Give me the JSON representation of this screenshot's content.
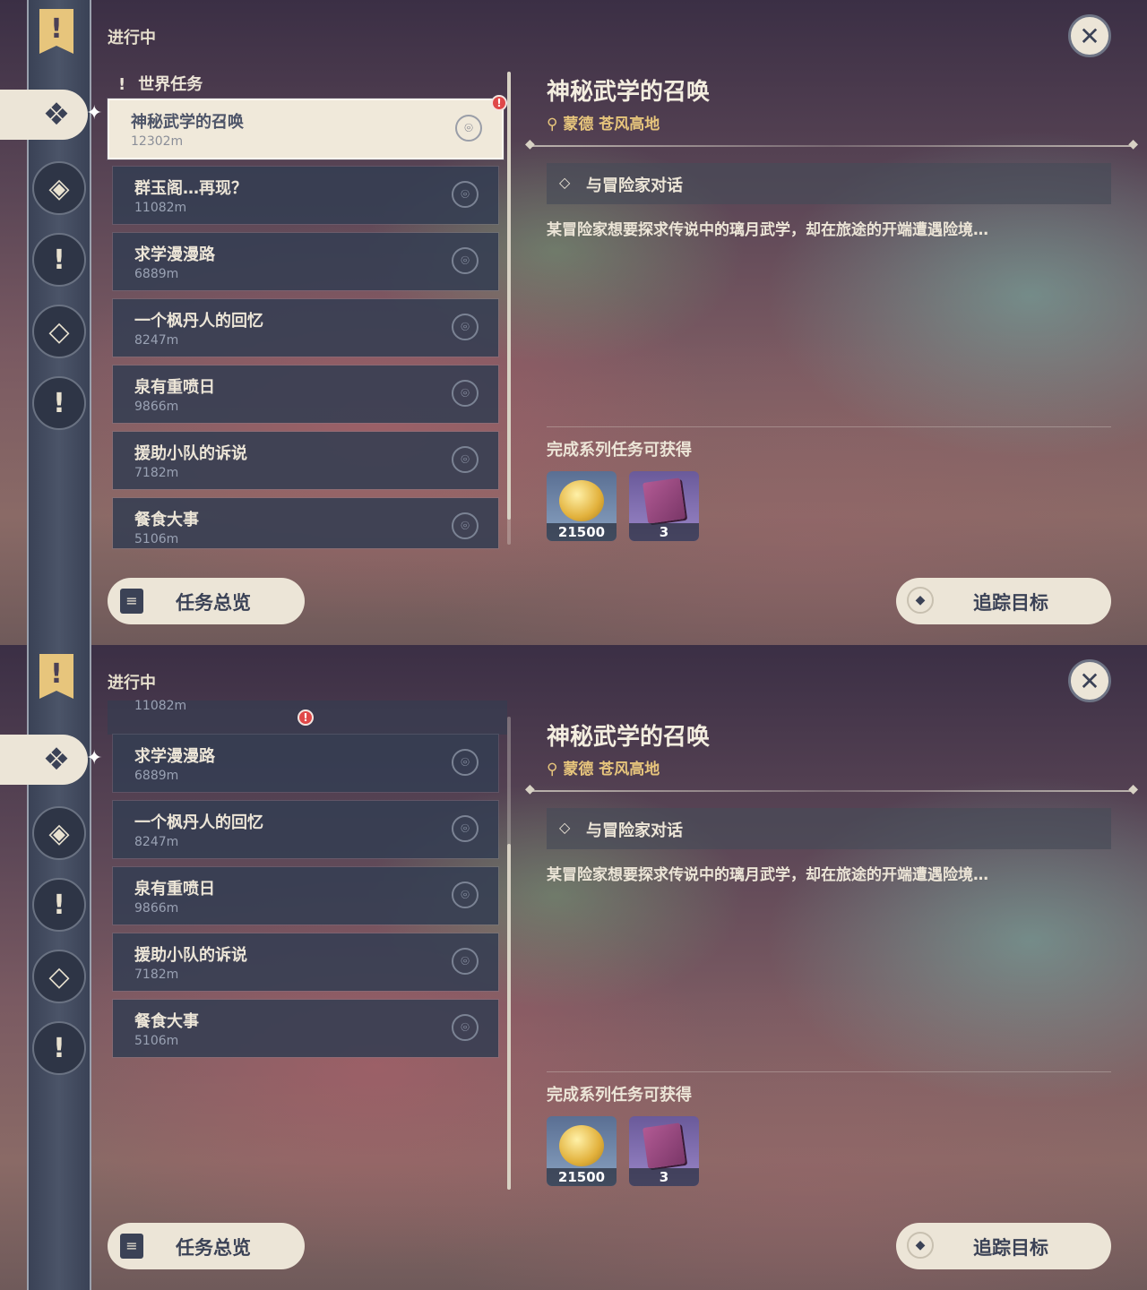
{
  "panels": [
    {
      "status_label": "进行中",
      "category_label": "世界任务",
      "close_label": "✕",
      "quests": [
        {
          "name": "神秘武学的召唤",
          "distance": "12302m"
        },
        {
          "name": "群玉阁…再现？",
          "distance": "11082m"
        },
        {
          "name": "求学漫漫路",
          "distance": "6889m"
        },
        {
          "name": "一个枫丹人的回忆",
          "distance": "8247m"
        },
        {
          "name": "泉有重喷日",
          "distance": "9866m"
        },
        {
          "name": "援助小队的诉说",
          "distance": "7182m"
        },
        {
          "name": "餐食大事",
          "distance": "5106m"
        }
      ],
      "detail": {
        "title": "神秘武学的召唤",
        "location": "蒙德 苍风高地",
        "objective": "与冒险家对话",
        "description": "某冒险家想要探求传说中的璃月武学，却在旅途的开端遭遇险境…",
        "rewards_label": "完成系列任务可获得",
        "rewards": [
          {
            "icon": "mora-coin-icon",
            "count": "21500"
          },
          {
            "icon": "book-icon",
            "count": "3"
          }
        ]
      },
      "overview_label": "任务总览",
      "track_label": "追踪目标"
    },
    {
      "status_label": "进行中",
      "top_partial_distance": "11082m",
      "close_label": "✕",
      "quests": [
        {
          "name": "求学漫漫路",
          "distance": "6889m"
        },
        {
          "name": "一个枫丹人的回忆",
          "distance": "8247m"
        },
        {
          "name": "泉有重喷日",
          "distance": "9866m"
        },
        {
          "name": "援助小队的诉说",
          "distance": "7182m"
        },
        {
          "name": "餐食大事",
          "distance": "5106m"
        }
      ],
      "detail": {
        "title": "神秘武学的召唤",
        "location": "蒙德 苍风高地",
        "objective": "与冒险家对话",
        "description": "某冒险家想要探求传说中的璃月武学，却在旅途的开端遭遇险境…",
        "rewards_label": "完成系列任务可获得",
        "rewards": [
          {
            "icon": "mora-coin-icon",
            "count": "21500"
          },
          {
            "icon": "book-icon",
            "count": "3"
          }
        ]
      },
      "overview_label": "任务总览",
      "track_label": "追踪目标"
    }
  ],
  "colors": {
    "accent_gold": "#e7c57c",
    "card_bg": "#ece5d7",
    "alert": "#e04848"
  }
}
